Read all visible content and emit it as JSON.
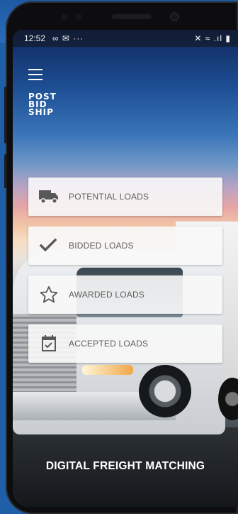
{
  "status_bar": {
    "time": "12:52",
    "left_icons": "∞ ✉ ···",
    "right_icons": "✕ ≈ .ıl ▮"
  },
  "logo_lines": [
    "POST",
    "BID",
    "SHIP"
  ],
  "menu": {
    "items": [
      {
        "label": "POTENTIAL LOADS",
        "icon": "truck-icon"
      },
      {
        "label": "BIDDED LOADS",
        "icon": "checkmark-icon"
      },
      {
        "label": "AWARDED LOADS",
        "icon": "star-icon"
      },
      {
        "label": "ACCEPTED LOADS",
        "icon": "calendar-check-icon"
      }
    ]
  },
  "tagline": "DIGITAL FREIGHT MATCHING",
  "colors": {
    "card_bg": "#f8f8f8",
    "icon": "#585858",
    "label": "#5e5e5e",
    "tagline": "#ffffff"
  }
}
